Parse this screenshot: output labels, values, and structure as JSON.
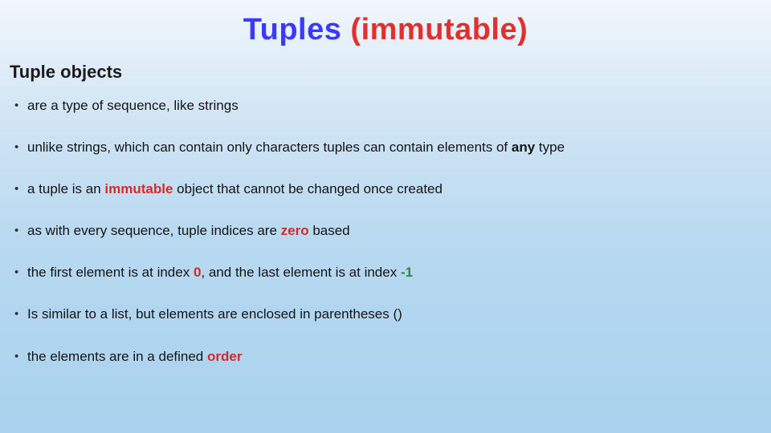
{
  "title": {
    "main": "Tuples ",
    "paren": "(immutable)"
  },
  "subheading": "Tuple objects",
  "bullets": [
    {
      "parts": [
        {
          "t": "are a type of sequence, like strings"
        }
      ]
    },
    {
      "parts": [
        {
          "t": "unlike strings, which can contain only characters tuples can contain elements of "
        },
        {
          "t": "any",
          "cls": "b"
        },
        {
          "t": " type"
        }
      ]
    },
    {
      "parts": [
        {
          "t": "a tuple is an "
        },
        {
          "t": "immutable",
          "cls": "r"
        },
        {
          "t": " object that cannot be changed once created"
        }
      ]
    },
    {
      "parts": [
        {
          "t": "as with every sequence, tuple indices are "
        },
        {
          "t": "zero",
          "cls": "r"
        },
        {
          "t": " based"
        }
      ]
    },
    {
      "parts": [
        {
          "t": "the first element is at index "
        },
        {
          "t": "0",
          "cls": "r"
        },
        {
          "t": ", and the last element is at index "
        },
        {
          "t": "-1",
          "cls": "g"
        }
      ]
    },
    {
      "parts": [
        {
          "t": "Is similar to a list, but elements are enclosed in parentheses ()"
        }
      ]
    },
    {
      "parts": [
        {
          "t": "the elements are in a defined "
        },
        {
          "t": "order",
          "cls": "r"
        }
      ]
    }
  ]
}
